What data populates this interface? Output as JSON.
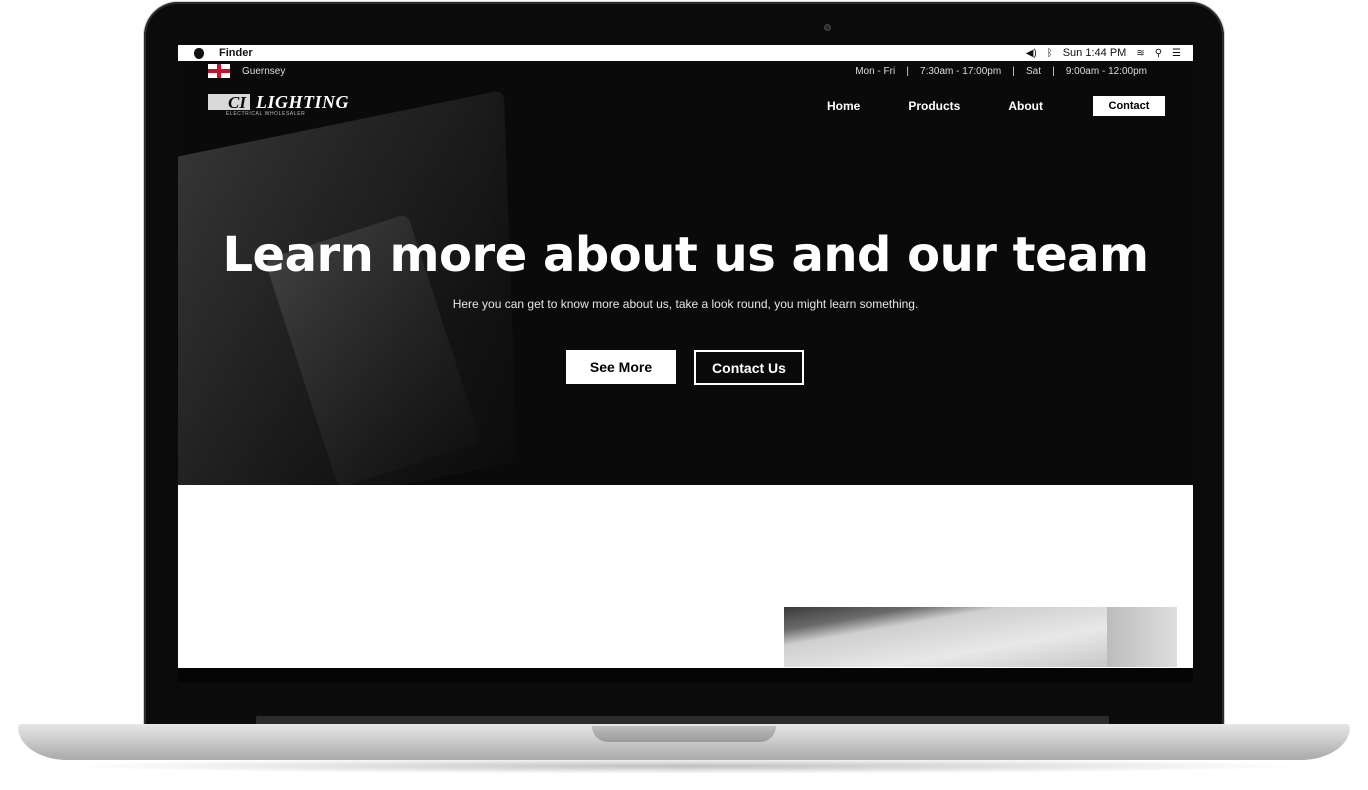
{
  "menubar": {
    "app": "Finder",
    "clock": "Sun 1:44 PM",
    "icons": [
      "apple-icon",
      "volume-icon",
      "bluetooth-icon",
      "wifi-icon",
      "search-icon",
      "list-icon"
    ]
  },
  "topbar": {
    "location": "Guernsey",
    "hours": "Mon - Fri    |    7:30am - 17:00pm    |    Sat    |    9:00am - 12:00pm"
  },
  "logo": {
    "mark": "CI",
    "name": "LIGHTING",
    "tagline": "ELECTRICAL WHOLESALER"
  },
  "nav": {
    "items": [
      {
        "label": "Home"
      },
      {
        "label": "Products"
      },
      {
        "label": "About"
      }
    ],
    "contact": "Contact"
  },
  "hero": {
    "title": "Learn more about us and our team",
    "subtitle": "Here you can get to know more about us, take a look round, you might learn something.",
    "primary_button": "See More",
    "secondary_button": "Contact Us"
  },
  "colors": {
    "hero_bg": "#0a0a0a",
    "text": "#ffffff",
    "accent_flag": "#c8102e"
  }
}
